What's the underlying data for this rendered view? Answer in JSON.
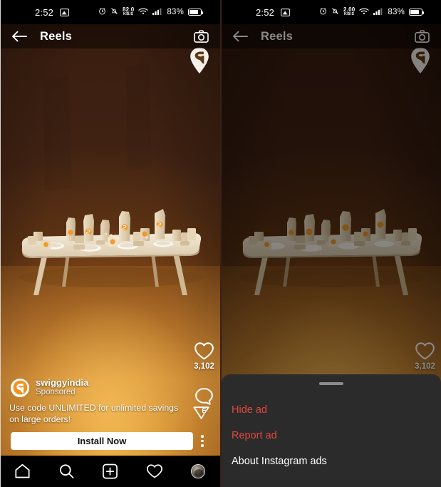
{
  "meta": {
    "app": "Instagram",
    "screen": "Reels",
    "variant_left": "reel ad playing",
    "variant_right": "ad options bottom sheet open"
  },
  "colors": {
    "accent_orange": "#F0931F",
    "danger_red": "#E0483E",
    "sheet_bg": "#2B2B2B",
    "bg_black": "#000000",
    "text_white": "#FFFFFF"
  },
  "status_bar_left": {
    "time": "2:52",
    "cast_icon": "screencast-icon",
    "alarm_icon": "alarm-icon",
    "mute_icon": "bell-off-icon",
    "net_speed_value": "82.0",
    "net_speed_unit": "KB/S",
    "wifi_icon": "wifi-icon",
    "signal_icon": "cellular-signal-icon",
    "battery_percent": "83%"
  },
  "status_bar_right": {
    "time": "2:52",
    "cast_icon": "screencast-icon",
    "alarm_icon": "alarm-icon",
    "mute_icon": "bell-off-icon",
    "net_speed_value": "2.00",
    "net_speed_unit": "KB/S",
    "wifi_icon": "wifi-icon",
    "signal_icon": "cellular-signal-icon",
    "battery_percent": "83%"
  },
  "header": {
    "back_icon": "back-arrow-icon",
    "title": "Reels",
    "camera_icon": "camera-icon"
  },
  "media": {
    "watermark_icon": "swiggy-pin-logo",
    "description": "3d rendered long table set with food packaging on warm orange backdrop"
  },
  "rail": {
    "like_icon": "heart-icon",
    "like_count": "3,102",
    "comment_icon": "comment-bubble-icon",
    "comment_count": "6"
  },
  "ad": {
    "avatar_icon": "swiggy-avatar",
    "username": "swiggyindia",
    "sponsored_label": "Sponsored",
    "caption": "Use code UNLIMITED for unlimited savings on large orders!",
    "share_icon": "share-paperplane-icon",
    "cta_label": "Install Now",
    "more_icon": "kebab-menu-icon"
  },
  "tabbar": {
    "items": [
      {
        "name": "home",
        "icon": "home-icon"
      },
      {
        "name": "search",
        "icon": "search-icon"
      },
      {
        "name": "create",
        "icon": "plus-square-icon"
      },
      {
        "name": "activity",
        "icon": "heart-icon"
      },
      {
        "name": "profile",
        "icon": "profile-avatar"
      }
    ]
  },
  "sheet": {
    "handle": "drag-handle",
    "options": [
      {
        "label": "Hide ad",
        "style": "danger"
      },
      {
        "label": "Report ad",
        "style": "danger"
      },
      {
        "label": "About Instagram ads",
        "style": "plain"
      }
    ]
  }
}
